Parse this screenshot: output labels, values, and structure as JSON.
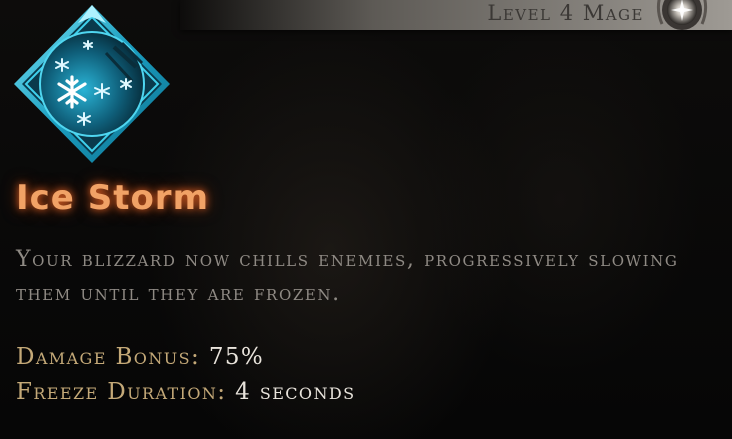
{
  "header": {
    "level_text": "Level 4 Mage",
    "class_emblem_icon": "mage-emblem-icon"
  },
  "ability": {
    "icon": "ice-storm-snowflake-icon",
    "title": "Ice Storm",
    "description": "Your blizzard now chills enemies, progressively slowing them until they are frozen."
  },
  "stats": [
    {
      "label": "Damage Bonus:",
      "value": "75%"
    },
    {
      "label": "Freeze Duration:",
      "value": "4 seconds"
    }
  ],
  "colors": {
    "title": "#f1a266",
    "title_glow": "#ff6e28",
    "description": "#8f8a84",
    "stat_label": "#c4a978",
    "stat_value": "#e9e4dc",
    "icon_accent": "#29c2e0"
  }
}
